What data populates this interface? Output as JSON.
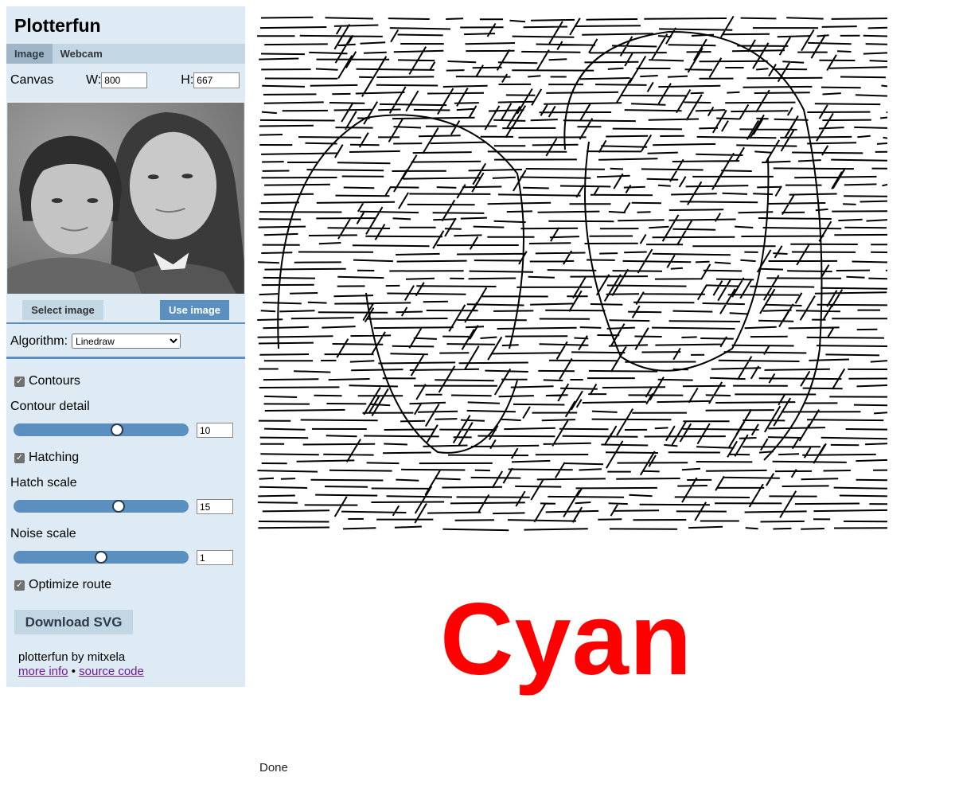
{
  "app": {
    "title": "Plotterfun"
  },
  "tabs": [
    {
      "label": "Image",
      "active": true
    },
    {
      "label": "Webcam",
      "active": false
    }
  ],
  "canvas": {
    "label": "Canvas",
    "w_label": "W:",
    "w_value": "800",
    "h_label": "H:",
    "h_value": "667"
  },
  "buttons": {
    "select": "Select image",
    "use": "Use image",
    "download": "Download SVG"
  },
  "algorithm": {
    "label": "Algorithm:",
    "selected": "Linedraw"
  },
  "controls": {
    "contours": {
      "label": "Contours",
      "checked": true
    },
    "contour_detail": {
      "label": "Contour detail",
      "value": "10",
      "level": 0.59
    },
    "hatching": {
      "label": "Hatching",
      "checked": true
    },
    "hatch_scale": {
      "label": "Hatch scale",
      "value": "15",
      "level": 0.6
    },
    "noise_scale": {
      "label": "Noise scale",
      "value": "1",
      "level": 0.5
    },
    "optimize": {
      "label": "Optimize route",
      "checked": true
    }
  },
  "footer": {
    "credit": "plotterfun by mitxela",
    "more_info": "more info",
    "sep": "•",
    "source": "source code"
  },
  "overlay": {
    "text": "Cyan",
    "color": "#ff0000"
  },
  "status": "Done"
}
